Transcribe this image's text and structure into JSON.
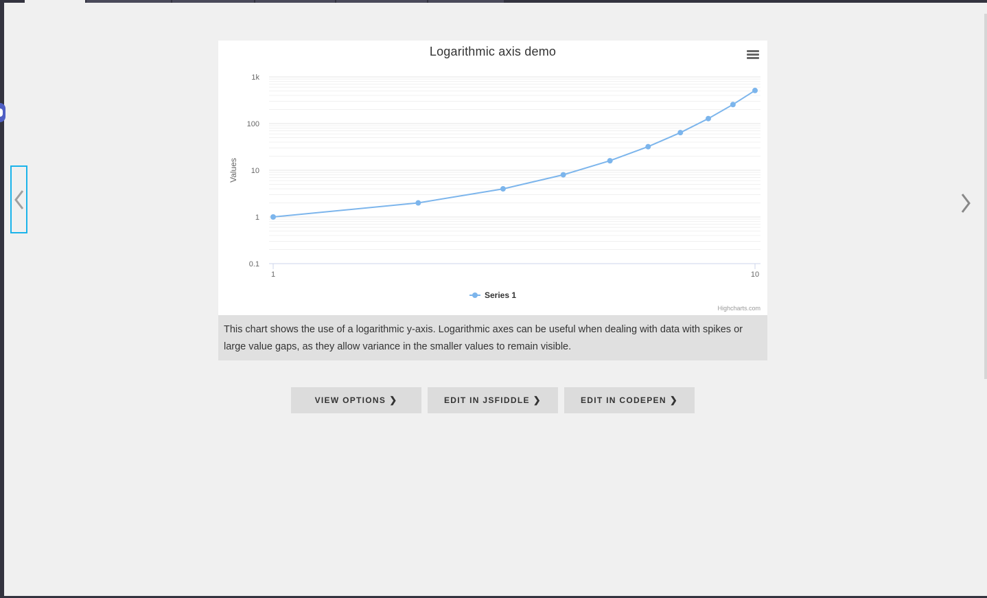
{
  "chart_card": {
    "menu_icon": "hamburger-menu-icon",
    "credits": "Highcharts.com"
  },
  "chart_data": {
    "type": "line",
    "title": "Logarithmic axis demo",
    "ylabel": "Values",
    "xlabel": "",
    "x_scale": "log",
    "y_scale": "log",
    "xlim": [
      1,
      10
    ],
    "ylim": [
      0.1,
      1000
    ],
    "x_ticks": [
      "1",
      "10"
    ],
    "y_ticks": [
      "0.1",
      "1",
      "10",
      "100",
      "1k"
    ],
    "series": [
      {
        "name": "Series 1",
        "color": "#7cb5ec",
        "x": [
          1,
          2,
          3,
          4,
          5,
          6,
          7,
          8,
          9,
          10
        ],
        "y": [
          1,
          2,
          4,
          8,
          16,
          32,
          64,
          128,
          256,
          512
        ]
      }
    ],
    "grid": true,
    "legend": "bottom-center"
  },
  "description": "This chart shows the use of a logarithmic y-axis. Logarithmic axes can be useful when dealing with data with spikes or large value gaps, as they allow variance in the smaller values to remain visible.",
  "buttons": {
    "view_options": "VIEW OPTIONS",
    "edit_jsfiddle": "EDIT IN JSFIDDLE",
    "edit_codepen": "EDIT IN CODEPEN"
  },
  "nav": {
    "prev_icon": "chevron-left-icon",
    "next_icon": "chevron-right-icon"
  }
}
